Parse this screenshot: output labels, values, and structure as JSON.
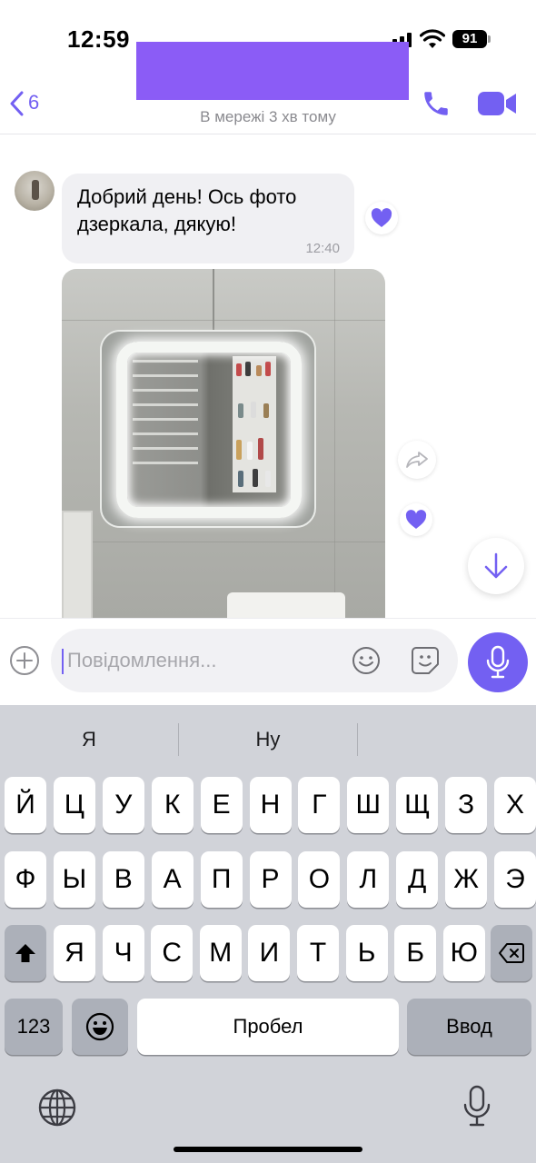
{
  "status_bar": {
    "time": "12:59",
    "battery": "91"
  },
  "header": {
    "back_count": "6",
    "contact_subtitle": "В мережі 3 хв тому"
  },
  "chat": {
    "message": {
      "text": "Добрий день! Ось фото дзеркала, дякую!",
      "time": "12:40"
    }
  },
  "composer": {
    "placeholder": "Повідомлення..."
  },
  "keyboard": {
    "suggestions": [
      "Я",
      "Ну",
      ""
    ],
    "row1": [
      "Й",
      "Ц",
      "У",
      "К",
      "Е",
      "Н",
      "Г",
      "Ш",
      "Щ",
      "З",
      "Х"
    ],
    "row2": [
      "Ф",
      "Ы",
      "В",
      "А",
      "П",
      "Р",
      "О",
      "Л",
      "Д",
      "Ж",
      "Э"
    ],
    "row3": [
      "Я",
      "Ч",
      "С",
      "М",
      "И",
      "Т",
      "Ь",
      "Б",
      "Ю"
    ],
    "numbers_label": "123",
    "space_label": "Пробел",
    "return_label": "Ввод"
  },
  "colors": {
    "accent": "#7360f2",
    "redaction": "#8b5cf6",
    "bubble": "#f0f0f3",
    "keyboard_bg": "#d1d3d9"
  }
}
